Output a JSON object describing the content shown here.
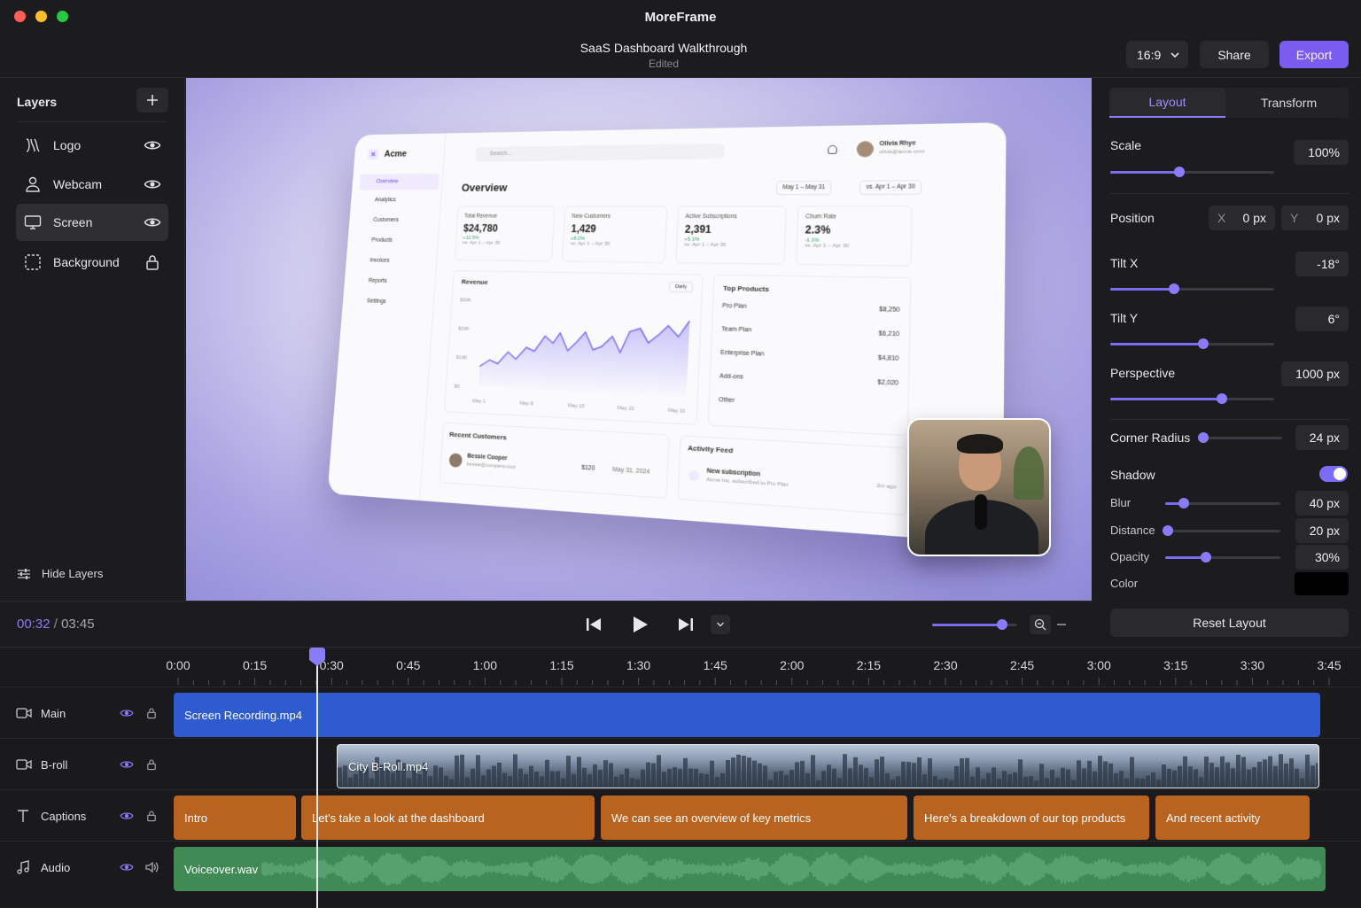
{
  "app": {
    "title": "MoreFrame"
  },
  "document": {
    "title": "SaaS Dashboard Walkthrough",
    "status": "Edited"
  },
  "header": {
    "aspect": "16:9",
    "share_label": "Share",
    "export_label": "Export"
  },
  "colors": {
    "accent": "#7b6cf6",
    "export": "#7b5cf0",
    "main_clip": "#2f5bd0",
    "caption_clip": "#b8631f",
    "audio_clip": "#3f8a55"
  },
  "layers_panel": {
    "title": "Layers",
    "items": [
      {
        "label": "Logo",
        "icon": "logo-icon",
        "state": "visible"
      },
      {
        "label": "Webcam",
        "icon": "person-icon",
        "state": "visible"
      },
      {
        "label": "Screen",
        "icon": "monitor-icon",
        "state": "visible"
      },
      {
        "label": "Background",
        "icon": "dashed-square-icon",
        "state": "locked"
      }
    ],
    "hide_label": "Hide Layers"
  },
  "properties": {
    "tabs": [
      "Layout",
      "Transform"
    ],
    "active_tab": "Layout",
    "scale": {
      "label": "Scale",
      "value": "100%",
      "level": 0.42
    },
    "position": {
      "label": "Position",
      "x_label": "X",
      "x_value": "0 px",
      "y_label": "Y",
      "y_value": "0 px"
    },
    "tilt_x": {
      "label": "Tilt X",
      "value": "-18°",
      "level": 0.39
    },
    "tilt_y": {
      "label": "Tilt Y",
      "value": "6°",
      "level": 0.57
    },
    "perspective": {
      "label": "Perspective",
      "value": "1000 px",
      "level": 0.68
    },
    "corner_radius": {
      "label": "Corner Radius",
      "value": "24 px",
      "level": 0.03
    },
    "shadow": {
      "label": "Shadow",
      "enabled": true,
      "blur": {
        "label": "Blur",
        "value": "40 px",
        "level": 0.16
      },
      "distance": {
        "label": "Distance",
        "value": "20 px",
        "level": 0.02
      },
      "opacity": {
        "label": "Opacity",
        "value": "30%",
        "level": 0.35
      },
      "color": {
        "label": "Color",
        "value": "#000000"
      }
    },
    "reset_label": "Reset Layout"
  },
  "playback": {
    "current": "00:32",
    "separator": "/",
    "total": "03:45",
    "zoom_level": 0.82
  },
  "timeline": {
    "ticks": [
      "0:00",
      "0:15",
      "0:30",
      "0:45",
      "1:00",
      "1:15",
      "1:30",
      "1:45",
      "2:00",
      "2:15",
      "2:30",
      "2:45",
      "3:00",
      "3:15",
      "3:30",
      "3:45"
    ],
    "playhead": "0:32",
    "tracks": [
      {
        "name": "Main",
        "icon": "video-icon"
      },
      {
        "name": "B-roll",
        "icon": "video-icon"
      },
      {
        "name": "Captions",
        "icon": "text-icon"
      },
      {
        "name": "Audio",
        "icon": "music-icon"
      }
    ],
    "clips": {
      "main": "Screen Recording.mp4",
      "broll": "City B-Roll.mp4",
      "captions": [
        "Intro",
        "Let's take a look at the dashboard",
        "We can see an overview of key metrics",
        "Here's a breakdown of our top products",
        "And recent activity"
      ],
      "audio": "Voiceover.wav"
    }
  },
  "preview": {
    "brand": "Acme",
    "search_placeholder": "Search...",
    "user_name": "Olivia Rhye",
    "user_email": "olivia@acme.com",
    "nav": [
      "Overview",
      "Analytics",
      "Customers",
      "Products",
      "Invoices",
      "Reports",
      "Settings"
    ],
    "page_title": "Overview",
    "date_range": "May 1 – May 31",
    "compare_range": "vs. Apr 1 – Apr 30",
    "kpis": [
      {
        "label": "Total Revenue",
        "value": "$24,780",
        "change": "+12.5%",
        "sub": "vs. Apr 1 – Apr 30"
      },
      {
        "label": "New Customers",
        "value": "1,429",
        "change": "+8.2%",
        "sub": "vs. Apr 1 – Apr 30"
      },
      {
        "label": "Active Subscriptions",
        "value": "2,391",
        "change": "+5.1%",
        "sub": "vs. Apr 1 – Apr 30"
      },
      {
        "label": "Churn Rate",
        "value": "2.3%",
        "change": "-1.1%",
        "sub": "vs. Apr 1 – Apr 30"
      }
    ],
    "revenue": {
      "title": "Revenue",
      "interval": "Daily",
      "y_ticks": [
        "$30K",
        "$20K",
        "$10K",
        "$0"
      ],
      "x_ticks": [
        "May 1",
        "May 8",
        "May 15",
        "May 22",
        "May 31"
      ]
    },
    "top_products": {
      "title": "Top Products",
      "items": [
        {
          "name": "Pro Plan",
          "value": "$8,250"
        },
        {
          "name": "Team Plan",
          "value": "$6,210"
        },
        {
          "name": "Enterprise Plan",
          "value": "$4,810"
        },
        {
          "name": "Add-ons",
          "value": "$2,020"
        },
        {
          "name": "Other",
          "value": ""
        }
      ]
    },
    "recent_customers": {
      "title": "Recent Customers",
      "name": "Bessie Cooper",
      "email": "bessie@company.com",
      "amount": "$120",
      "date": "May 31, 2024"
    },
    "activity": {
      "title": "Activity Feed",
      "event": "New subscription",
      "detail": "Acme Inc. subscribed to Pro Plan",
      "time": "2m ago"
    }
  }
}
